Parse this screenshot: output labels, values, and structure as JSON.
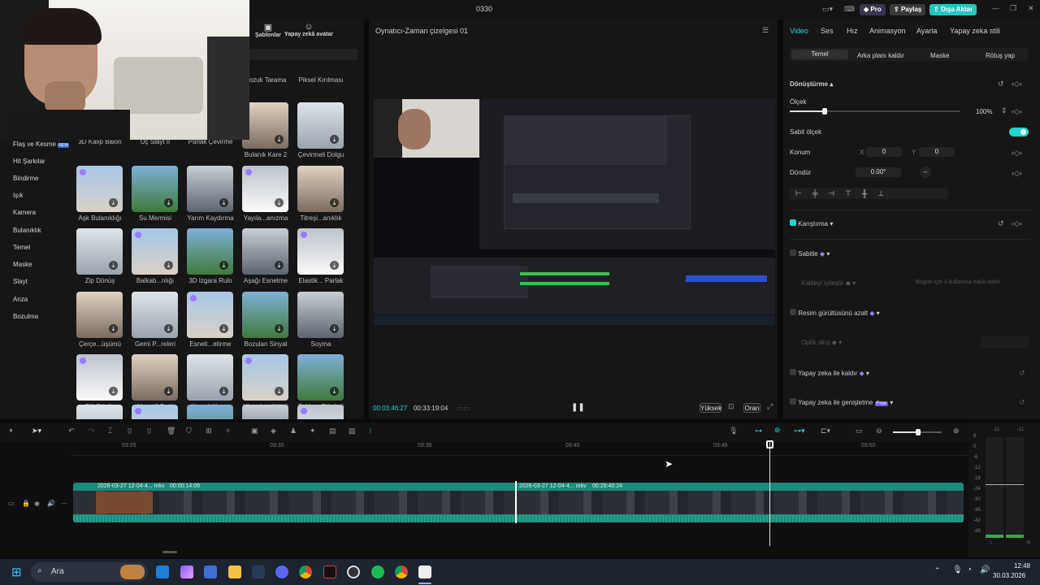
{
  "window": {
    "title": "0330",
    "pro": "Pro",
    "share": "Paylaş",
    "export": "Dışa Aktar"
  },
  "topnav": {
    "templates": "Şablonlar",
    "ai_avatar": "Yapay zekâ avatar"
  },
  "categories": [
    "Flaş ve Kesme",
    "Hit Şarkılar",
    "Bindirme",
    "Işık",
    "Kamera",
    "Bulanıklık",
    "Temel",
    "Maske",
    "Slayt",
    "Anza",
    "Bozulma"
  ],
  "categories_badge": "NEW",
  "effects": [
    {
      "label": "Bozuk Tarama"
    },
    {
      "label": "Piksel Kırılması"
    },
    {
      "label": "3D Kalıp Balon"
    },
    {
      "label": "Üç Slayt II"
    },
    {
      "label": "Parlak Çevirme"
    },
    {
      "label": "Bulanık Kare 2"
    },
    {
      "label": "Çevirmeli Dolgu"
    },
    {
      "label": "Aşk Bulanıklığı"
    },
    {
      "label": "Su Mermisi"
    },
    {
      "label": "Yarım Kaydırma"
    },
    {
      "label": "Yayıla...anızma"
    },
    {
      "label": "Titreşi...anıklık"
    },
    {
      "label": "Zip Dönüş"
    },
    {
      "label": "Balkab...nlığı"
    },
    {
      "label": "3D Izgara Rulo"
    },
    {
      "label": "Aşağı Esnetme"
    },
    {
      "label": "Elastik... Parlak"
    },
    {
      "label": "Çerçe...üşümü"
    },
    {
      "label": "Gemi P...releri"
    },
    {
      "label": "Esneti...etirme"
    },
    {
      "label": "Bozulan Sinyal"
    },
    {
      "label": "Soyma"
    },
    {
      "label": "Çift Dönüş"
    },
    {
      "label": "Negatif Şerit"
    },
    {
      "label": "Kanşık Kaset"
    },
    {
      "label": "Uhrevi ...rültüsü"
    },
    {
      "label": "Çoklu ...Dönüşü"
    }
  ],
  "player": {
    "title": "Oynatıcı-Zaman çizelgesi 01",
    "current_time": "00:03:46:27",
    "total_time": "00:33:19:04",
    "quality": "Yüksek",
    "ratio": "Oran"
  },
  "inspector": {
    "tabs": [
      "Video",
      "Ses",
      "Hız",
      "Animasyon",
      "Ayarla",
      "Yapay zeka stili"
    ],
    "subtabs": [
      "Temel",
      "Arka planı kaldır",
      "Maske",
      "Rötuş yap"
    ],
    "transform": "Dönüştürme",
    "scale": "Ölçek",
    "scale_value": "100%",
    "uniform_scale": "Sabit ölçek",
    "position": "Konum",
    "pos_x_label": "X",
    "pos_x": "0",
    "pos_y_label": "Y",
    "pos_y": "0",
    "rotate": "Döndür",
    "rotate_value": "0.00°",
    "blend": "Karıştırma",
    "stabilize": "Sabitle",
    "enhance_quality": "Kaliteyi iyileştir",
    "enhance_hint": "Bugün için 3 kullanma hakkı kaldı",
    "denoise": "Resim gürültüsünü azalt",
    "optical_flow": "Optik akış",
    "ai_remove": "Yapay zeka ile kaldır",
    "ai_expand": "Yapay zeka ile genişletme",
    "ai_expand_badge": "Free"
  },
  "timeline": {
    "ruler": [
      "03:25",
      "03:30",
      "03:35",
      "03:40",
      "03:45",
      "03:50"
    ],
    "clip1_name": "2026-03-27 12-04-4... mkv",
    "clip1_dur": "00:00:14:09",
    "clip2_name": "2026-03-27 12-04-4... mkv",
    "clip2_dur": "00:29:40:24"
  },
  "meter": {
    "scale": [
      "6",
      "0",
      "-6",
      "-12",
      "-18",
      "-24",
      "-30",
      "-36",
      "-42",
      "-48"
    ],
    "top": [
      "-11",
      "-11"
    ],
    "l": "L",
    "r": "R"
  },
  "taskbar": {
    "search": "Ara",
    "time": "12:48",
    "date": "30.03.2026"
  },
  "colors": {
    "accent": "#20d5d0",
    "clip": "#1b8a7c",
    "background": "#161617"
  }
}
